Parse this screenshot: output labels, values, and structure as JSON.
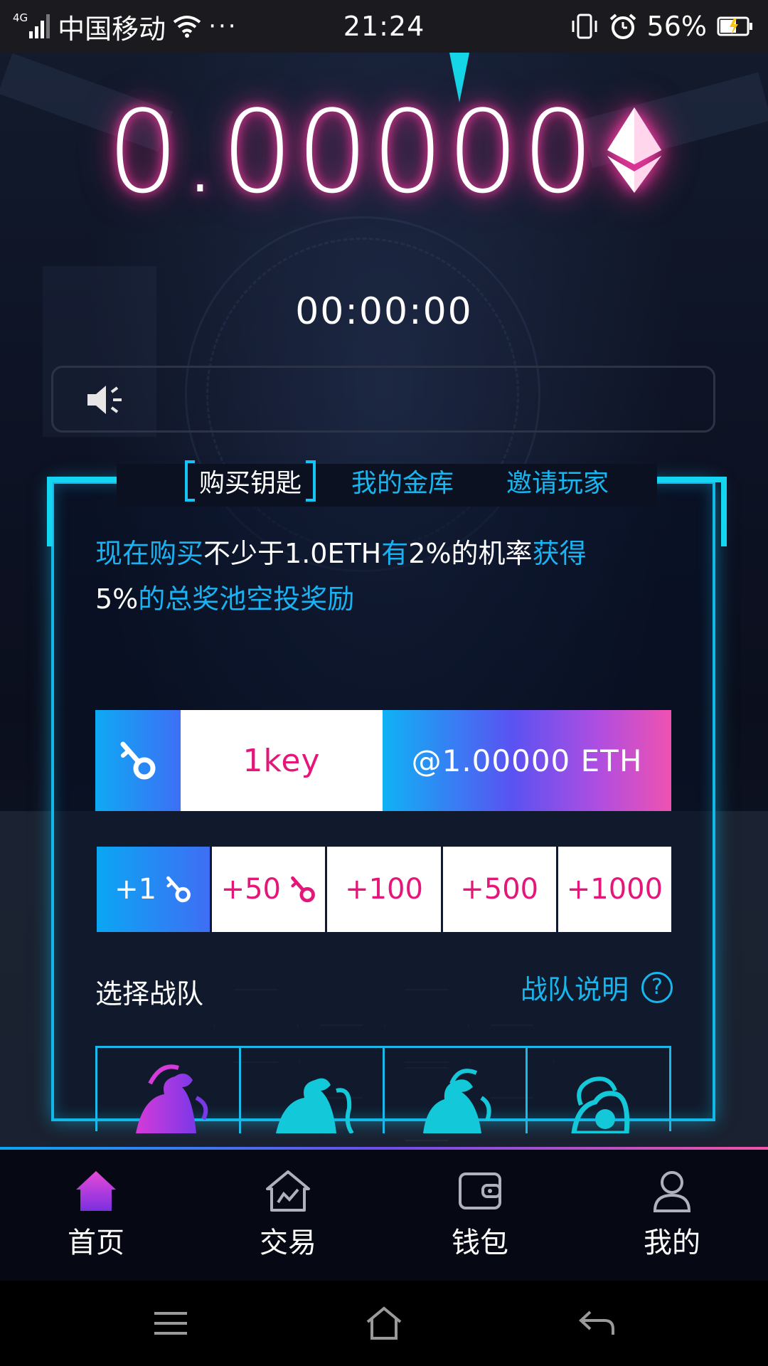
{
  "status_bar": {
    "network_type": "4G",
    "carrier": "中国移动",
    "more": "···",
    "time": "21:24",
    "battery": "56%"
  },
  "balance": {
    "value": "0.00000",
    "currency_icon": "eth-icon"
  },
  "timer": "00:00:00",
  "notice": {
    "icon": "speaker-icon",
    "text": ""
  },
  "tabs": [
    {
      "label": "购买钥匙",
      "active": true
    },
    {
      "label": "我的金库",
      "active": false
    },
    {
      "label": "邀请玩家",
      "active": false
    }
  ],
  "promo": {
    "part1": "现在购买",
    "part2": "不少于1.0ETH",
    "part3": "有",
    "part4": "2%的机率",
    "part5": "获得",
    "part6": "5%",
    "part7": "的总奖池空投奖励"
  },
  "buy": {
    "quantity": "1key",
    "price": "@1.00000 ETH"
  },
  "increments": [
    {
      "label": "+1",
      "has_key_icon": true,
      "active": true
    },
    {
      "label": "+50",
      "has_key_icon": true,
      "active": false
    },
    {
      "label": "+100",
      "has_key_icon": false,
      "active": false
    },
    {
      "label": "+500",
      "has_key_icon": false,
      "active": false
    },
    {
      "label": "+1000",
      "has_key_icon": false,
      "active": false
    }
  ],
  "team": {
    "label": "选择战队",
    "help": "战队说明",
    "help_icon": "?"
  },
  "bottom_nav": [
    {
      "label": "首页",
      "icon": "home-icon",
      "active": true
    },
    {
      "label": "交易",
      "icon": "exchange-icon",
      "active": false
    },
    {
      "label": "钱包",
      "icon": "wallet-icon",
      "active": false
    },
    {
      "label": "我的",
      "icon": "profile-icon",
      "active": false
    }
  ],
  "colors": {
    "accent_cyan": "#18b6ef",
    "accent_pink": "#e4167a",
    "glow_pink": "#ff3fa6",
    "nav_active_purple": "#b13ce6"
  }
}
